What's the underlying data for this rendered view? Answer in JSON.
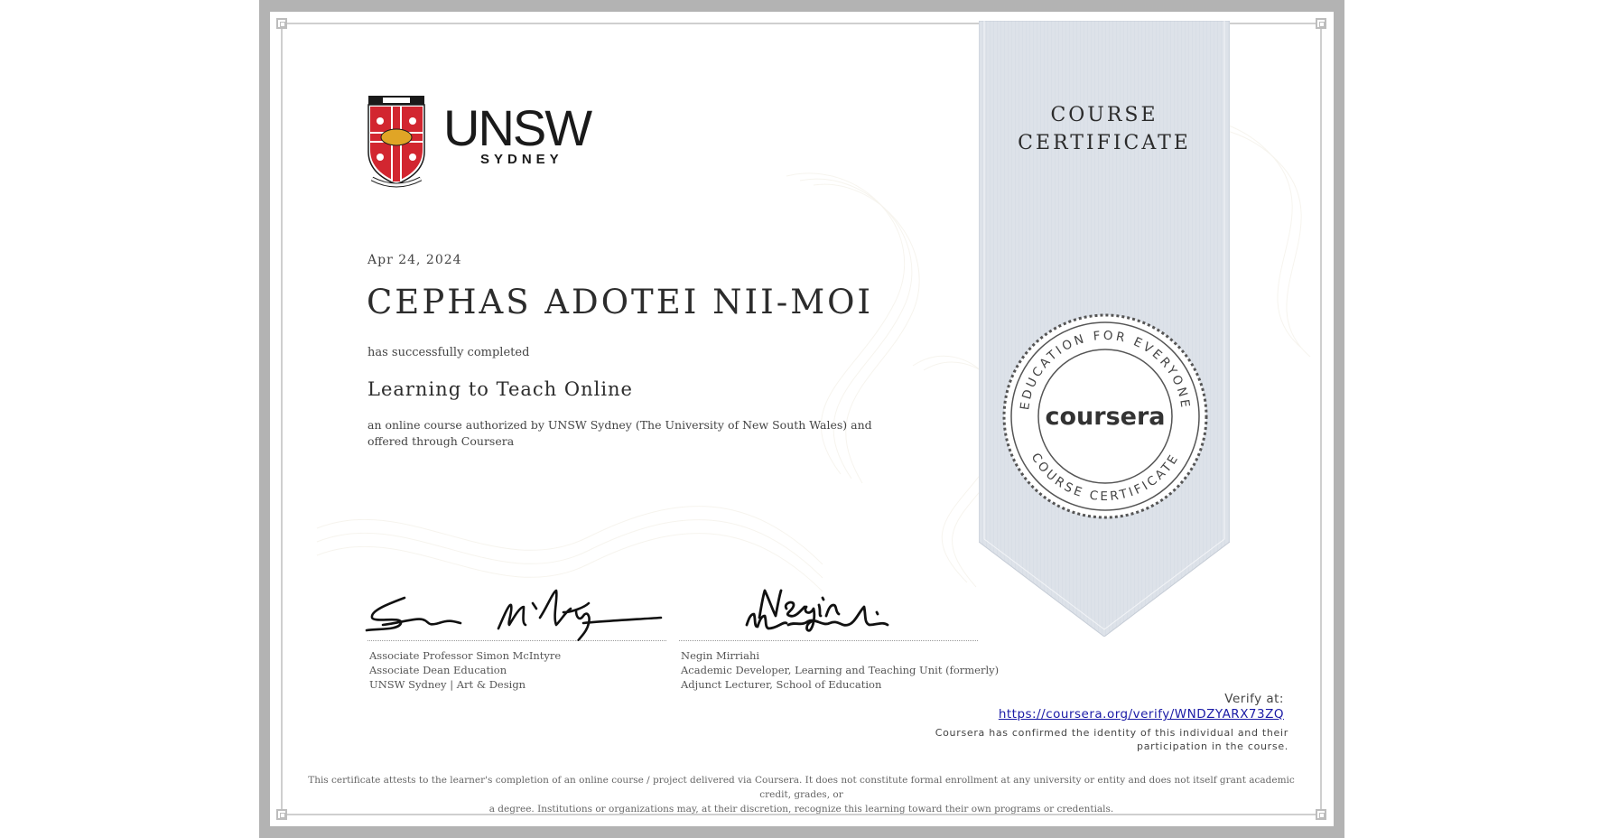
{
  "certificate": {
    "ribbon_title_line1": "COURSE",
    "ribbon_title_line2": "CERTIFICATE",
    "institution": {
      "name": "UNSW",
      "subname": "SYDNEY"
    },
    "date": "Apr 24, 2024",
    "recipient": "CEPHAS ADOTEI NII-MOI",
    "completed_text": "has successfully completed",
    "course_title": "Learning to Teach Online",
    "description": "an online course authorized by UNSW Sydney (The University of New South Wales) and offered through Coursera",
    "signatories": [
      {
        "lines": [
          "Associate Professor Simon McIntyre",
          "Associate Dean Education",
          "UNSW Sydney | Art & Design"
        ]
      },
      {
        "lines": [
          "Negin Mirriahi",
          "Academic Developer, Learning and Teaching Unit (formerly)",
          "Adjunct Lecturer, School of Education"
        ]
      }
    ],
    "seal": {
      "brand": "coursera",
      "ring_top": "EDUCATION FOR EVERYONE",
      "ring_bottom": "COURSE CERTIFICATE"
    },
    "verify_label": "Verify at:",
    "verify_url": "https://coursera.org/verify/WNDZYARX73ZQ",
    "confirm_text_line1": "Coursera has confirmed the identity of this individual and their",
    "confirm_text_line2": "participation in the course.",
    "disclaimer_line1": "This certificate attests to the learner's completion of an online course / project delivered via Coursera. It does not constitute formal enrollment at any university or entity and does not itself grant academic credit, grades, or",
    "disclaimer_line2": "a degree. Institutions or organizations may, at their discretion, recognize this learning toward their own programs or credentials."
  },
  "colors": {
    "frame": "#b3b3b3",
    "ribbon": "#dde2e9",
    "text_dark": "#2c2c2c",
    "link": "#1a1aa6",
    "crest_red": "#d22630",
    "crest_gold": "#e0a526"
  }
}
